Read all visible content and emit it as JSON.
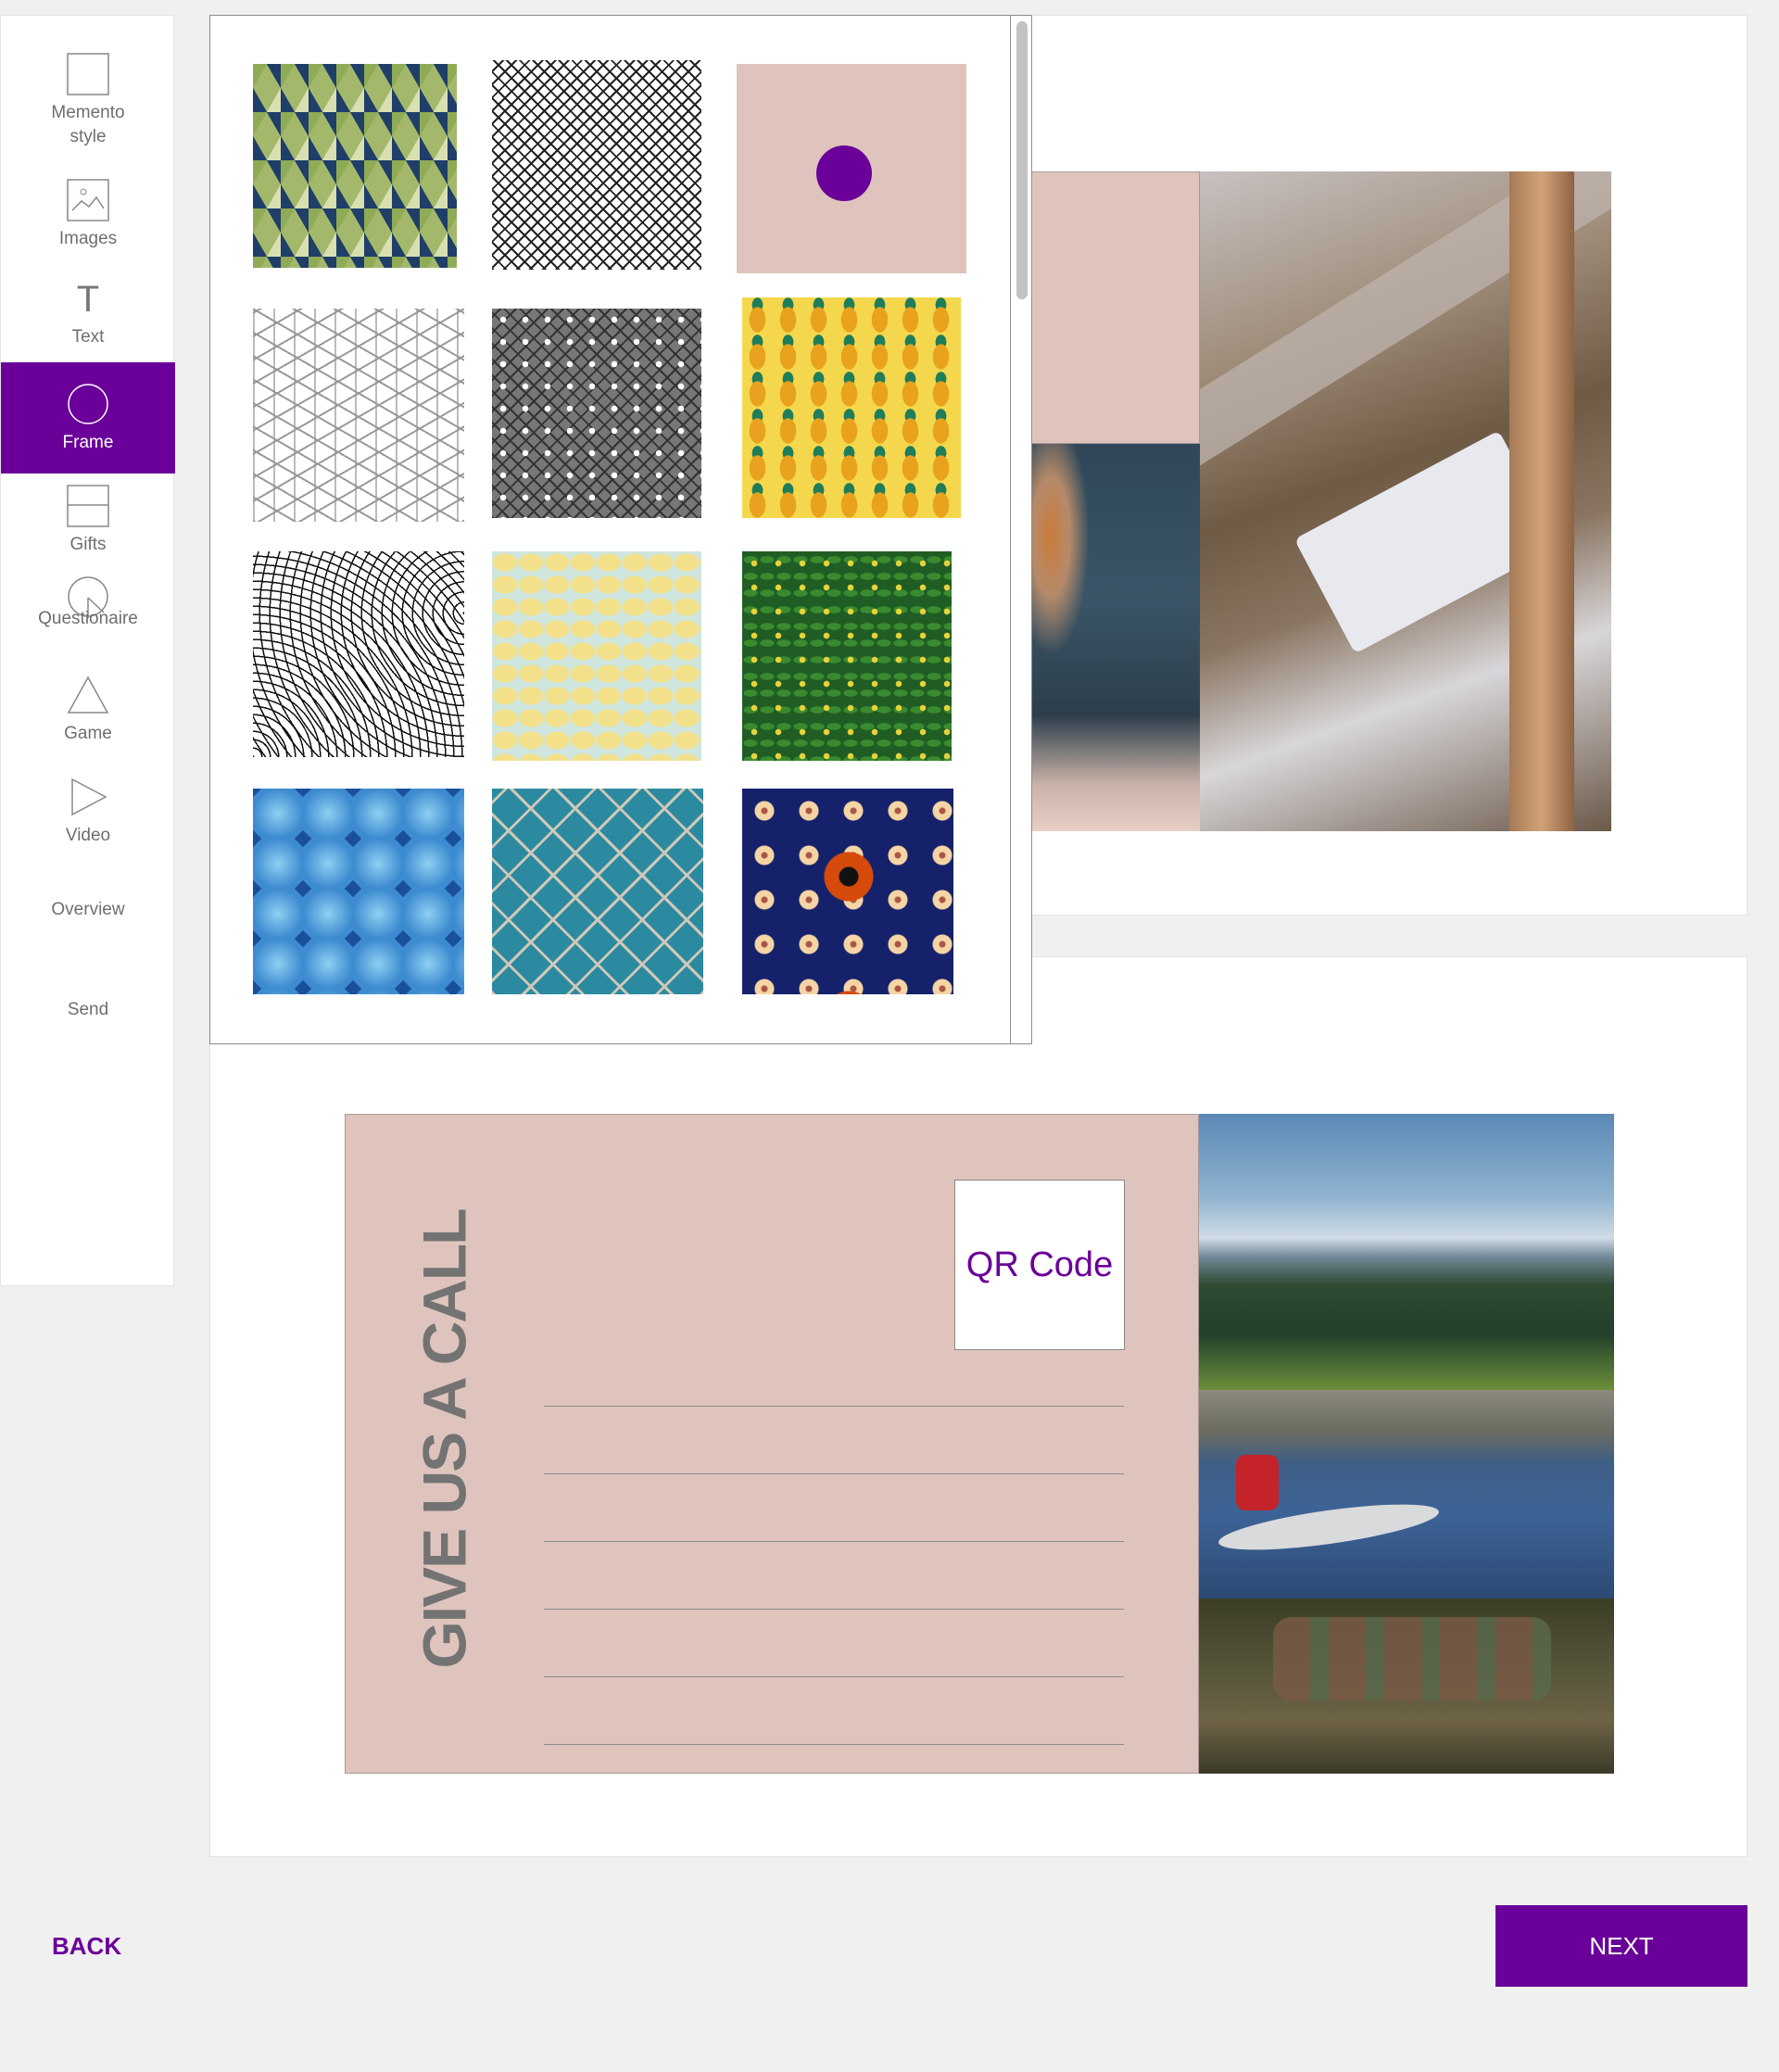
{
  "sidebar": {
    "items": [
      {
        "label": "Memento\nstyle",
        "icon": "square-icon",
        "active": false
      },
      {
        "label": "Images",
        "icon": "image-icon",
        "active": false
      },
      {
        "label": "Text",
        "icon": "text-icon",
        "active": false
      },
      {
        "label": "Frame",
        "icon": "circle-icon",
        "active": true
      },
      {
        "label": "Gifts",
        "icon": "gift-icon",
        "active": false
      },
      {
        "label": "Questionaire",
        "icon": "questionnaire-icon",
        "active": false
      },
      {
        "label": "Game",
        "icon": "triangle-icon",
        "active": false
      },
      {
        "label": "Video",
        "icon": "play-icon",
        "active": false
      },
      {
        "label": "Overview",
        "icon": "",
        "active": false
      },
      {
        "label": "Send",
        "icon": "",
        "active": false
      }
    ],
    "accent_color": "#6a0099"
  },
  "frame_picker": {
    "swatches": [
      {
        "name": "triangles-green-navy"
      },
      {
        "name": "black-white-lattice"
      },
      {
        "name": "pink-dot-frame"
      },
      {
        "name": "white-cube-pattern"
      },
      {
        "name": "grey-lattice"
      },
      {
        "name": "pineapples-yellow"
      },
      {
        "name": "line-leaves-bw"
      },
      {
        "name": "yellow-blobs"
      },
      {
        "name": "green-floral"
      },
      {
        "name": "blue-glass-tiles"
      },
      {
        "name": "teal-mosaic-tiles"
      },
      {
        "name": "navy-orange-dots"
      }
    ]
  },
  "memento_back": {
    "vertical_text": "GIVE US A CALL",
    "qr_label": "QR Code",
    "background_color": "#dfc4bd"
  },
  "footer": {
    "back_label": "BACK",
    "next_label": "NEXT"
  }
}
